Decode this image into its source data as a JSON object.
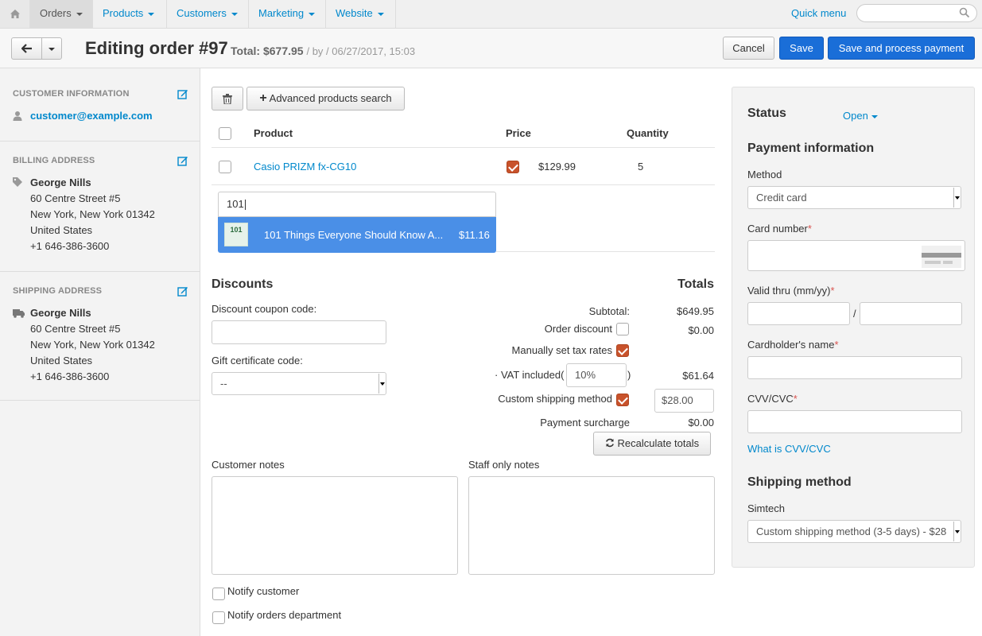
{
  "nav": {
    "items": [
      "Orders",
      "Products",
      "Customers",
      "Marketing",
      "Website"
    ],
    "quick_menu": "Quick menu",
    "search_placeholder": ""
  },
  "header": {
    "title": "Editing order #97",
    "total_label": "Total:",
    "total_value": "$677.95",
    "meta": "/ by / 06/27/2017, 15:03",
    "cancel": "Cancel",
    "save": "Save",
    "save_process": "Save and process payment"
  },
  "sidebar": {
    "customer": {
      "heading": "Customer information",
      "email": "customer@example.com"
    },
    "billing": {
      "heading": "Billing address",
      "name": "George Nills",
      "street": "60 Centre Street #5",
      "city": "New York, New York 01342",
      "country": "United States",
      "phone": "+1 646-386-3600"
    },
    "shipping": {
      "heading": "Shipping address",
      "name": "George Nills",
      "street": "60 Centre Street #5",
      "city": "New York, New York 01342",
      "country": "United States",
      "phone": "+1 646-386-3600"
    }
  },
  "products": {
    "adv_search": "Advanced products search",
    "col_product": "Product",
    "col_price": "Price",
    "col_quantity": "Quantity",
    "rows": [
      {
        "name": "Casio PRIZM fx-CG10",
        "price": "$129.99",
        "quantity": "5"
      }
    ],
    "search_value": "101",
    "suggestion": {
      "thumb": "101",
      "name": "101 Things Everyone Should Know A...",
      "price": "$11.16"
    }
  },
  "discounts": {
    "heading": "Discounts",
    "coupon_label": "Discount coupon code:",
    "coupon_value": "",
    "gift_label": "Gift certificate code:",
    "gift_value": "--"
  },
  "totals": {
    "heading": "Totals",
    "subtotal_label": "Subtotal:",
    "subtotal_value": "$649.95",
    "order_discount_label": "Order discount",
    "order_discount_value": "$0.00",
    "manual_tax_label": "Manually set tax rates",
    "vat_label": "· VAT included(",
    "vat_rate": "10%",
    "vat_close": ")",
    "vat_value": "$61.64",
    "custom_shipping_label": "Custom shipping method",
    "custom_shipping_value": "$28.00",
    "surcharge_label": "Payment surcharge",
    "surcharge_value": "$0.00",
    "recalc": "Recalculate totals"
  },
  "notes": {
    "customer_label": "Customer notes",
    "staff_label": "Staff only notes",
    "notify_customer": "Notify customer",
    "notify_orders": "Notify orders department"
  },
  "panel": {
    "status_label": "Status",
    "status_value": "Open",
    "payment_heading": "Payment information",
    "method_label": "Method",
    "method_value": "Credit card",
    "card_number_label": "Card number",
    "valid_thru_label": "Valid thru (mm/yy)",
    "valid_sep": "/",
    "cardholder_label": "Cardholder's name",
    "cvv_label": "CVV/CVC",
    "cvv_link": "What is CVV/CVC",
    "shipping_heading": "Shipping method",
    "shipping_carrier": "Simtech",
    "shipping_value": "Custom shipping method (3-5 days) - $28",
    "required_mark": "*"
  },
  "colors": {
    "link": "#0088cc",
    "primary": "#1a6ed8",
    "checkbox_on": "#c8522b",
    "highlight": "#4a8fe7"
  }
}
